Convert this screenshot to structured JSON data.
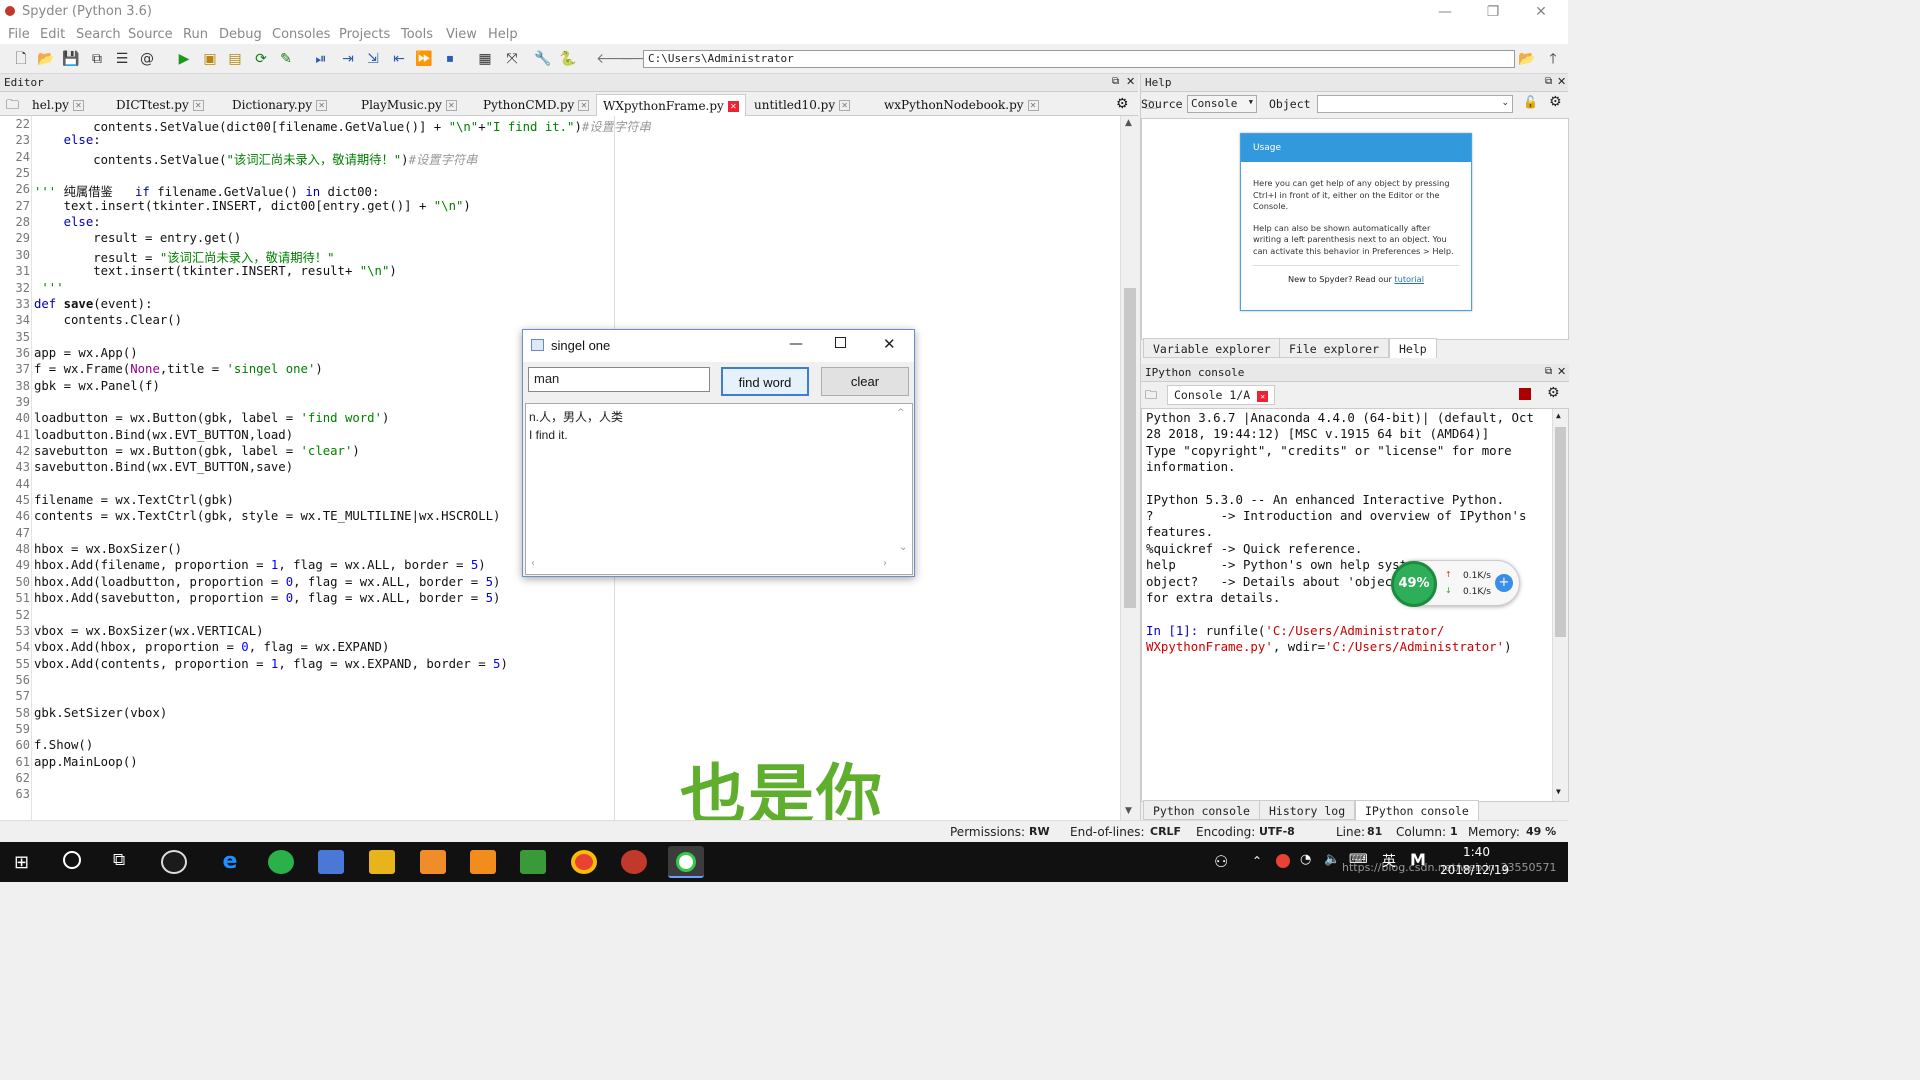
{
  "window": {
    "title": "Spyder (Python 3.6)",
    "minimize": "—",
    "restore": "❐",
    "close": "✕"
  },
  "menu": [
    "File",
    "Edit",
    "Search",
    "Source",
    "Run",
    "Debug",
    "Consoles",
    "Projects",
    "Tools",
    "View",
    "Help"
  ],
  "toolbar": {
    "path": "C:\\Users\\Administrator"
  },
  "editor": {
    "header": "Editor",
    "tabs": [
      "hel.py",
      "DICTtest.py",
      "Dictionary.py",
      "PlayMusic.py",
      "PythonCMD.py",
      "WXpythonFrame.py",
      "untitled10.py",
      "wxPythonNodebook.py"
    ],
    "active_tab": 5,
    "line_numbers": [
      "22",
      "23",
      "24",
      "25",
      "26",
      "27",
      "28",
      "29",
      "30",
      "31",
      "32",
      "33",
      "34",
      "35",
      "36",
      "37",
      "38",
      "39",
      "40",
      "41",
      "42",
      "43",
      "44",
      "45",
      "46",
      "47",
      "48",
      "49",
      "50",
      "51",
      "52",
      "53",
      "54",
      "55",
      "56",
      "57",
      "58",
      "59",
      "60",
      "61",
      "62",
      "63"
    ],
    "lines": [
      "        contents.SetValue(dict00[filename.GetValue()] + \"\\n\"+\"I find it.\")#设置字符串",
      "    else:",
      "        contents.SetValue(\"该词汇尚未录入，敬请期待！\")#设置字符串",
      "",
      "''' 纯属借鉴   if filename.GetValue() in dict00:",
      "    text.insert(tkinter.INSERT, dict00[entry.get()] + \"\\n\")",
      "    else:",
      "        result = entry.get()",
      "        result = \"该词汇尚未录入，敬请期待！\"",
      "        text.insert(tkinter.INSERT, result+ \"\\n\")",
      " '''",
      "def save(event):",
      "    contents.Clear()",
      "",
      "app = wx.App()",
      "f = wx.Frame(None,title = 'singel one')",
      "gbk = wx.Panel(f)",
      "",
      "loadbutton = wx.Button(gbk, label = 'find word')",
      "loadbutton.Bind(wx.EVT_BUTTON,load)",
      "savebutton = wx.Button(gbk, label = 'clear')",
      "savebutton.Bind(wx.EVT_BUTTON,save)",
      "",
      "filename = wx.TextCtrl(gbk)",
      "contents = wx.TextCtrl(gbk, style = wx.TE_MULTILINE|wx.HSCROLL)",
      "",
      "hbox = wx.BoxSizer()",
      "hbox.Add(filename, proportion = 1, flag = wx.ALL, border = 5)",
      "hbox.Add(loadbutton, proportion = 0, flag = wx.ALL, border = 5)",
      "hbox.Add(savebutton, proportion = 0, flag = wx.ALL, border = 5)",
      "",
      "vbox = wx.BoxSizer(wx.VERTICAL)",
      "vbox.Add(hbox, proportion = 0, flag = wx.EXPAND)",
      "vbox.Add(contents, proportion = 1, flag = wx.EXPAND, border = 5)",
      "",
      "",
      "gbk.SetSizer(vbox)",
      "",
      "f.Show()",
      "app.MainLoop()",
      "",
      ""
    ]
  },
  "help": {
    "header": "Help",
    "source_label": "Source",
    "source_value": "Console",
    "object_label": "Object",
    "usage_title": "Usage",
    "usage_p1": "Here you can get help of any object by pressing Ctrl+I in front of it, either on the Editor or the Console.",
    "usage_p2": "Help can also be shown automatically after writing a left parenthesis next to an object. You can activate this behavior in Preferences > Help.",
    "usage_new": "New to Spyder? Read our",
    "usage_link": "tutorial",
    "tabs": [
      "Variable explorer",
      "File explorer",
      "Help"
    ]
  },
  "console": {
    "header": "IPython console",
    "tab": "Console 1/A",
    "lines": [
      "Python 3.6.7 |Anaconda 4.4.0 (64-bit)| (default, Oct",
      "28 2018, 19:44:12) [MSC v.1915 64 bit (AMD64)]",
      "Type \"copyright\", \"credits\" or \"license\" for more",
      "information.",
      "",
      "IPython 5.3.0 -- An enhanced Interactive Python.",
      "?         -> Introduction and overview of IPython's",
      "features.",
      "%quickref -> Quick reference.",
      "help      -> Python's own help syst",
      "object?   -> Details about 'objec",
      "for extra details."
    ],
    "in_prompt": "In [1]:",
    "in_cmd": " runfile(",
    "in_arg1": "'C:/Users/Administrator/",
    "in_arg1b": "WXpythonFrame.py'",
    "in_mid": ", wdir=",
    "in_arg2": "'C:/Users/Administrator'",
    "in_end": ")",
    "tabs": [
      "Python console",
      "History log",
      "IPython console"
    ]
  },
  "dialog": {
    "title": "singel one",
    "input_value": "man",
    "find_button": "find word",
    "clear_button": "clear",
    "output": "n.人，男人，人类\nI find it."
  },
  "status": {
    "permissions_label": "Permissions:",
    "permissions": "RW",
    "eol_label": "End-of-lines:",
    "eol": "CRLF",
    "encoding_label": "Encoding:",
    "encoding": "UTF-8",
    "line_label": "Line:",
    "line": "81",
    "column_label": "Column:",
    "column": "1",
    "memory_label": "Memory:",
    "memory": "49 %"
  },
  "net_widget": {
    "percent": "49%",
    "up": "0.1K/s",
    "down": "0.1K/s"
  },
  "watermark": "也是你",
  "taskbar": {
    "time": "1:40",
    "date": "2018/12/19",
    "ime": "英",
    "url": "https://blog.csdn.net/weixin_33550571"
  }
}
